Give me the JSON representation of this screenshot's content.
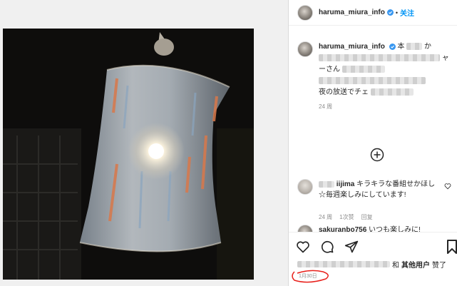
{
  "post": {
    "username": "haruma_miura_info",
    "follow_label": "关注",
    "separator": "•"
  },
  "caption": {
    "username": "haruma_miura_info",
    "text_line1": "本",
    "text_line1b": "か",
    "text_line2_end": "ャ",
    "text_line3": "ーさん",
    "text_line4": "夜の放送でチェ",
    "time": "24 周"
  },
  "comment": {
    "username": "iijima",
    "text": "キラキラな番組せかほし☆毎週楽しみにしています!",
    "time": "24 周",
    "replies": "1次赞",
    "reply_label": "回复"
  },
  "comment2": {
    "username": "sakuranbo756",
    "text": "いつも楽しみに!"
  },
  "footer": {
    "likes_prefix": "和",
    "likes_others": "其他用户",
    "likes_suffix": "赞了",
    "date": "1月30日"
  },
  "colors": {
    "follow": "#0095f6",
    "verified": "#3897f0",
    "annotation": "#e8201b"
  }
}
